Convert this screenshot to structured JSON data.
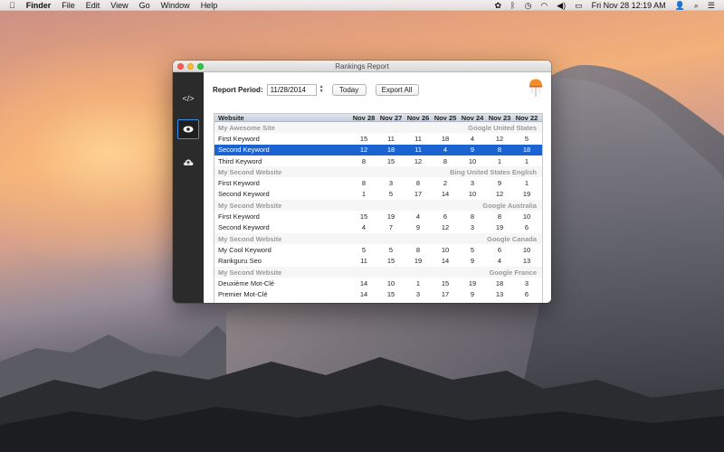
{
  "menubar": {
    "apple_icon": "apple-logo-icon",
    "app_name": "Finder",
    "menus": [
      "File",
      "Edit",
      "View",
      "Go",
      "Window",
      "Help"
    ],
    "clock": "Fri Nov 28  12:19 AM"
  },
  "window": {
    "title": "Rankings Report"
  },
  "sidebar": {
    "items": [
      {
        "name": "code-icon",
        "glyph": "</>"
      },
      {
        "name": "eye-icon",
        "glyph": "◉",
        "active": true
      },
      {
        "name": "cloud-upload-icon",
        "glyph": "☁"
      }
    ]
  },
  "toolbar": {
    "period_label": "Report Period:",
    "period_value": "11/28/2014",
    "today_label": "Today",
    "export_label": "Export All"
  },
  "table": {
    "columns": [
      "Website",
      "Nov 28",
      "Nov 27",
      "Nov 26",
      "Nov 25",
      "Nov 24",
      "Nov 23",
      "Nov 22"
    ],
    "rows": [
      {
        "type": "group",
        "name": "My Awesome Site",
        "engine": "Google United States"
      },
      {
        "type": "kw",
        "name": "First Keyword",
        "values": [
          "15",
          "11",
          "11",
          "18",
          "4",
          "12",
          "5"
        ]
      },
      {
        "type": "kw",
        "name": "Second Keyword",
        "values": [
          "12",
          "18",
          "11",
          "4",
          "9",
          "8",
          "18"
        ],
        "selected": true
      },
      {
        "type": "kw",
        "name": "Third Keyword",
        "values": [
          "8",
          "15",
          "12",
          "8",
          "10",
          "1",
          "1"
        ]
      },
      {
        "type": "group",
        "name": "My Second Website",
        "engine": "Bing United States English"
      },
      {
        "type": "kw",
        "name": "First Keyword",
        "values": [
          "8",
          "3",
          "8",
          "2",
          "3",
          "9",
          "1"
        ]
      },
      {
        "type": "kw",
        "name": "Second Keyword",
        "values": [
          "1",
          "5",
          "17",
          "14",
          "10",
          "12",
          "19"
        ]
      },
      {
        "type": "group",
        "name": "My Second Website",
        "engine": "Google Australia"
      },
      {
        "type": "kw",
        "name": "First Keyword",
        "values": [
          "15",
          "19",
          "4",
          "6",
          "8",
          "8",
          "10"
        ]
      },
      {
        "type": "kw",
        "name": "Second Keyword",
        "values": [
          "4",
          "7",
          "9",
          "12",
          "3",
          "19",
          "6"
        ]
      },
      {
        "type": "group",
        "name": "My Second Website",
        "engine": "Google Canada"
      },
      {
        "type": "kw",
        "name": "My Cool Keyword",
        "values": [
          "5",
          "5",
          "8",
          "10",
          "5",
          "6",
          "10"
        ]
      },
      {
        "type": "kw",
        "name": "Rankguru Seo",
        "values": [
          "11",
          "15",
          "19",
          "14",
          "9",
          "4",
          "13"
        ]
      },
      {
        "type": "group",
        "name": "My Second Website",
        "engine": "Google France"
      },
      {
        "type": "kw",
        "name": "Deuxième Mot-Clé",
        "values": [
          "14",
          "10",
          "1",
          "15",
          "19",
          "18",
          "3"
        ]
      },
      {
        "type": "kw",
        "name": "Premier Mot-Clé",
        "values": [
          "14",
          "15",
          "3",
          "17",
          "9",
          "13",
          "6"
        ]
      }
    ]
  },
  "colors": {
    "selection": "#1b63d0",
    "sidebar": "#2b2b2b",
    "active_border": "#3a8ee6"
  }
}
